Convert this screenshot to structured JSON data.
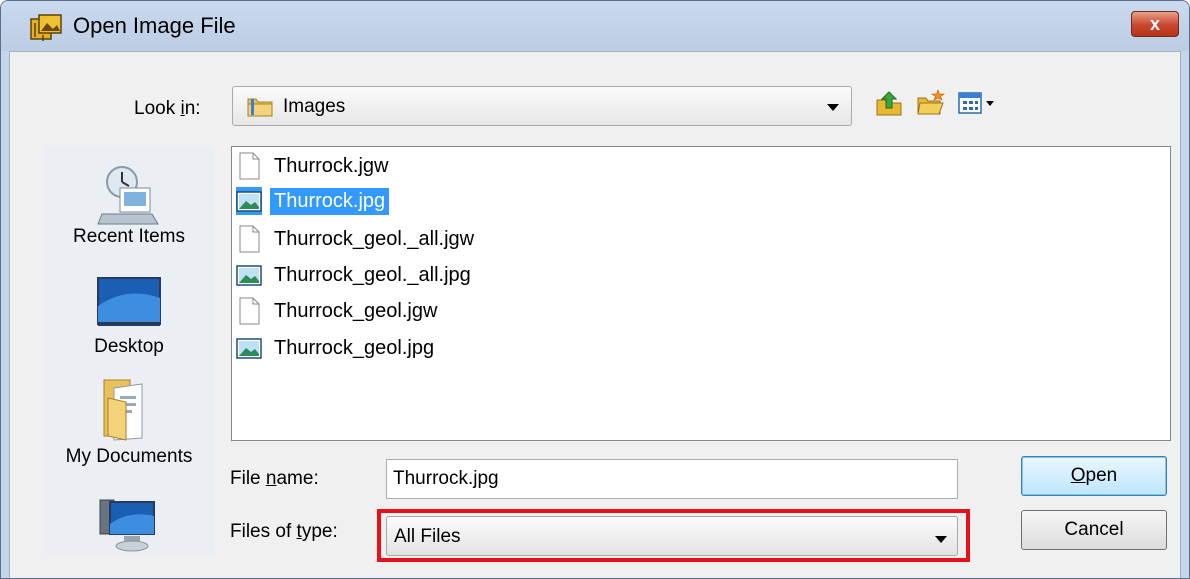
{
  "window": {
    "title": "Open Image File",
    "close_label": "x"
  },
  "lookin": {
    "label_pre": "Look ",
    "label_accel": "i",
    "label_post": "n:",
    "value": "Images"
  },
  "toolbar": {
    "icons": [
      "up-one-level-icon",
      "create-new-folder-icon",
      "view-menu-icon"
    ]
  },
  "places": [
    {
      "label": "Recent Items",
      "icon": "recent-items-icon"
    },
    {
      "label": "Desktop",
      "icon": "desktop-icon"
    },
    {
      "label": "My Documents",
      "icon": "my-documents-icon"
    },
    {
      "label": "",
      "icon": "computer-icon"
    }
  ],
  "files": [
    {
      "name": "Thurrock.jgw",
      "type": "document",
      "selected": false
    },
    {
      "name": "Thurrock.jpg",
      "type": "image",
      "selected": true
    },
    {
      "name": "Thurrock_geol._all.jgw",
      "type": "document",
      "selected": false
    },
    {
      "name": "Thurrock_geol._all.jpg",
      "type": "image",
      "selected": false
    },
    {
      "name": "Thurrock_geol.jgw",
      "type": "document",
      "selected": false
    },
    {
      "name": "Thurrock_geol.jpg",
      "type": "image",
      "selected": false
    }
  ],
  "filename": {
    "label_pre": "File ",
    "label_accel": "n",
    "label_post": "ame:",
    "value": "Thurrock.jpg"
  },
  "filetype": {
    "label_pre": "Files of ",
    "label_accel": "t",
    "label_post": "ype:",
    "value": "All Files"
  },
  "buttons": {
    "open_accel": "O",
    "open_rest": "pen",
    "cancel": "Cancel"
  },
  "colors": {
    "selection": "#3399ff",
    "highlight_box": "#e8101a",
    "frame": "#c5d5ea"
  }
}
